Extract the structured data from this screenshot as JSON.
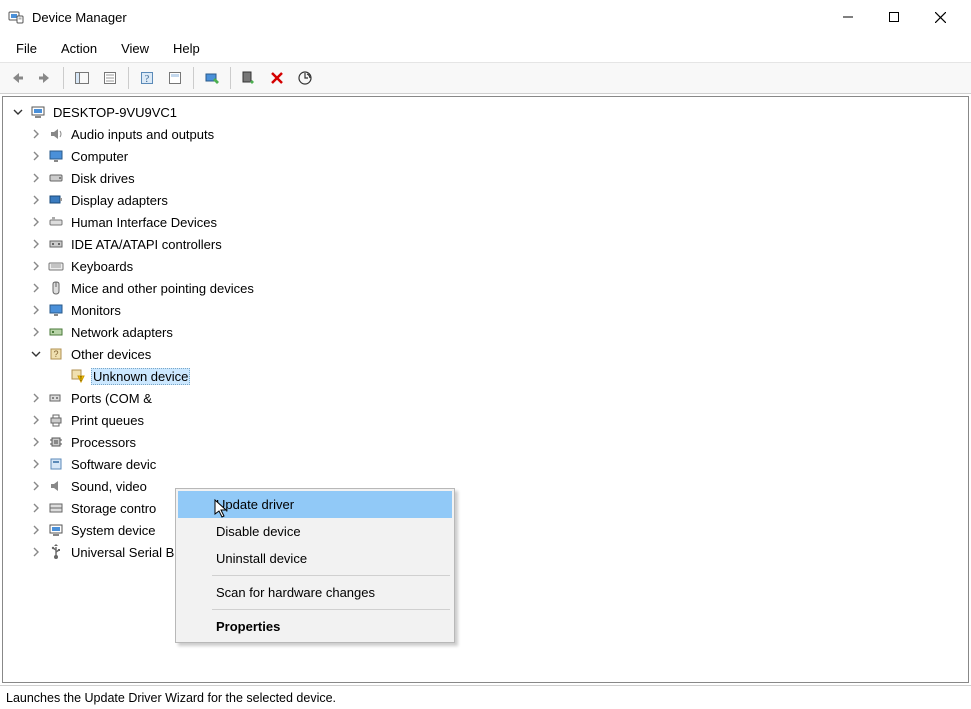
{
  "window": {
    "title": "Device Manager"
  },
  "menu": {
    "file": "File",
    "action": "Action",
    "view": "View",
    "help": "Help"
  },
  "tree": {
    "root": "DESKTOP-9VU9VC1",
    "audio": "Audio inputs and outputs",
    "computer": "Computer",
    "disk": "Disk drives",
    "display": "Display adapters",
    "hid": "Human Interface Devices",
    "ide": "IDE ATA/ATAPI controllers",
    "keyboards": "Keyboards",
    "mice": "Mice and other pointing devices",
    "monitors": "Monitors",
    "network": "Network adapters",
    "other": "Other devices",
    "unknown": "Unknown device",
    "ports": "Ports (COM &",
    "print": "Print queues",
    "processors": "Processors",
    "software": "Software devic",
    "sound": "Sound, video ",
    "storage": "Storage contro",
    "system": "System device",
    "usb": "Universal Serial Bus controllers"
  },
  "context_menu": {
    "update": "Update driver",
    "disable": "Disable device",
    "uninstall": "Uninstall device",
    "scan": "Scan for hardware changes",
    "properties": "Properties"
  },
  "statusbar": {
    "text": "Launches the Update Driver Wizard for the selected device."
  }
}
